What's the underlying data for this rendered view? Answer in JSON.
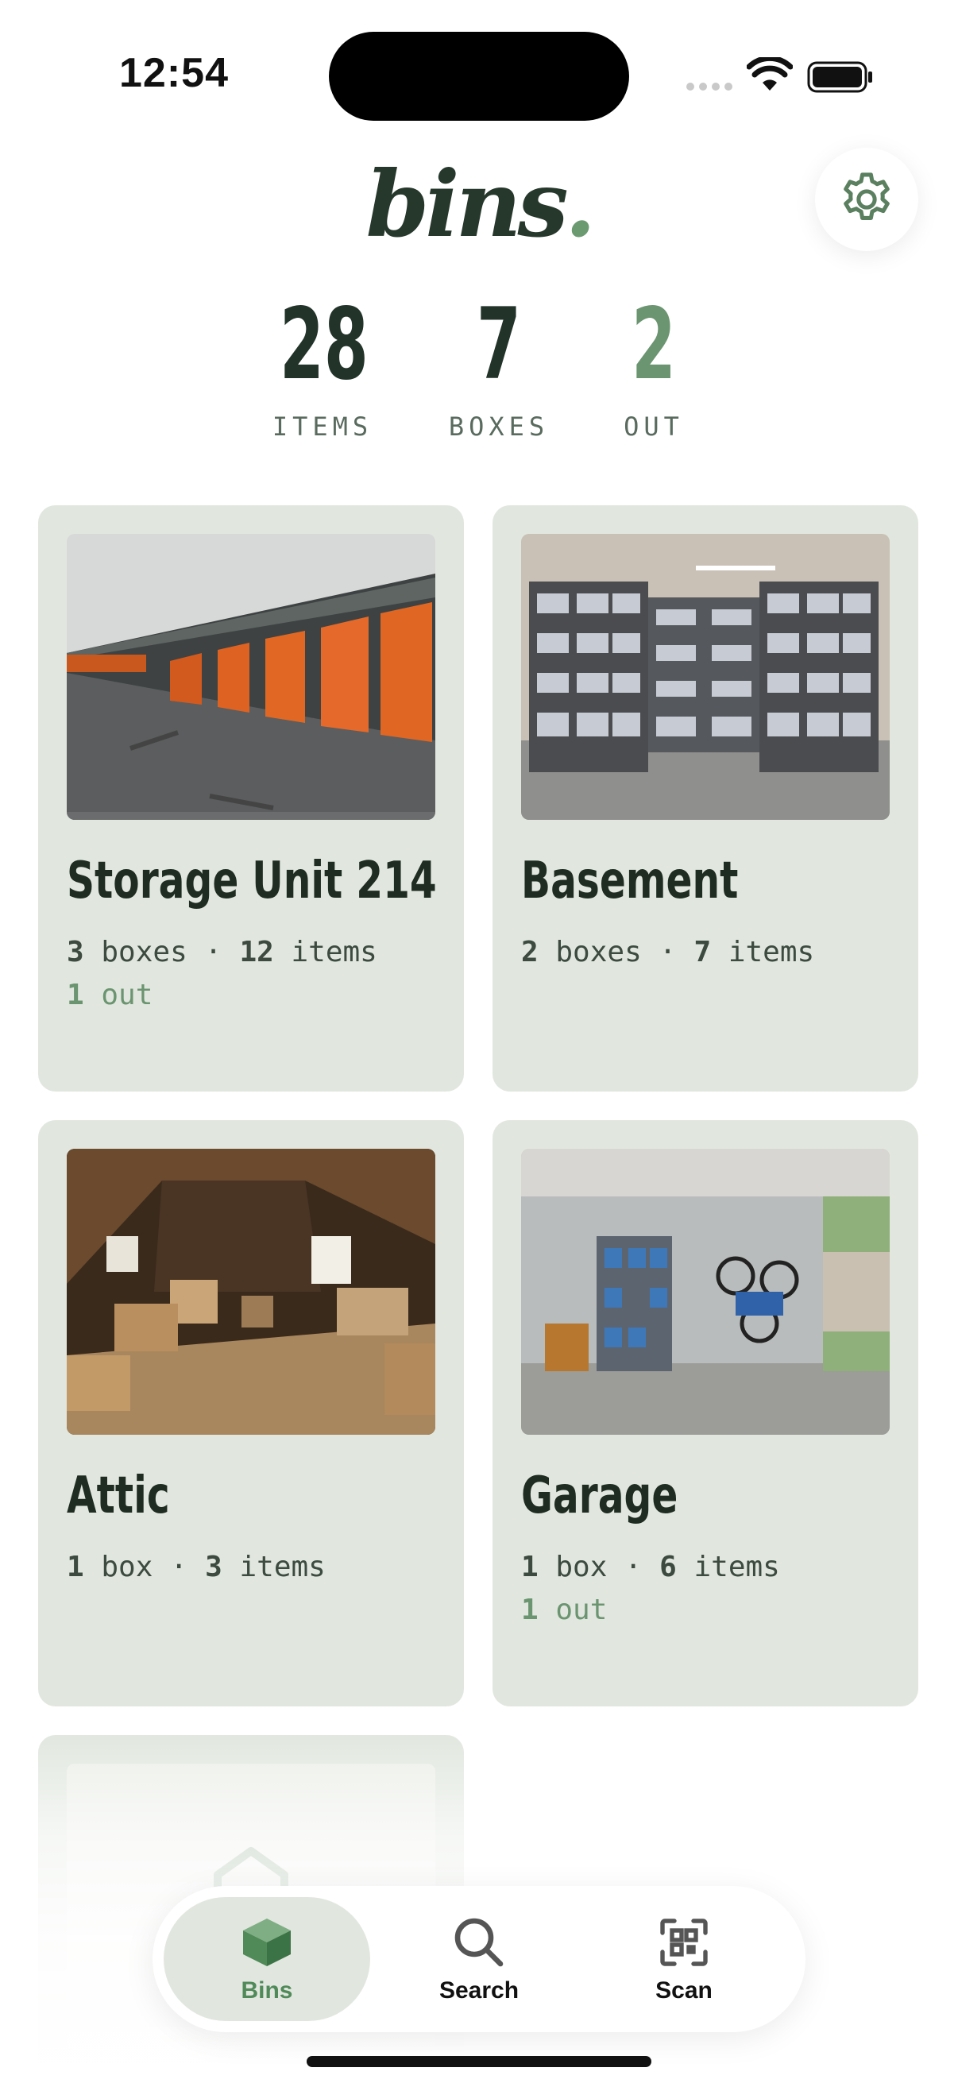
{
  "status_bar": {
    "time": "12:54"
  },
  "header": {
    "brand": "bins",
    "brand_dot": "."
  },
  "stats": [
    {
      "value": "28",
      "label": "ITEMS"
    },
    {
      "value": "7",
      "label": "BOXES"
    },
    {
      "value": "2",
      "label": "OUT"
    }
  ],
  "bins": [
    {
      "name": "Storage Unit 214",
      "boxes_count": "3",
      "boxes_word": "boxes",
      "items_count": "12",
      "items_word": "items",
      "out_count": "1",
      "out_word": "out"
    },
    {
      "name": "Basement",
      "boxes_count": "2",
      "boxes_word": "boxes",
      "items_count": "7",
      "items_word": "items"
    },
    {
      "name": "Attic",
      "boxes_count": "1",
      "boxes_word": "box",
      "items_count": "3",
      "items_word": "items"
    },
    {
      "name": "Garage",
      "boxes_count": "1",
      "boxes_word": "box",
      "items_count": "6",
      "items_word": "items",
      "out_count": "1",
      "out_word": "out"
    }
  ],
  "meta_separator": "·",
  "tabs": [
    {
      "label": "Bins",
      "icon": "box-icon",
      "active": true
    },
    {
      "label": "Search",
      "icon": "search-icon"
    },
    {
      "label": "Scan",
      "icon": "qr-scan-icon"
    }
  ],
  "colors": {
    "accent": "#6b9470",
    "card_bg": "#e1e7df",
    "brand": "#26382c"
  }
}
